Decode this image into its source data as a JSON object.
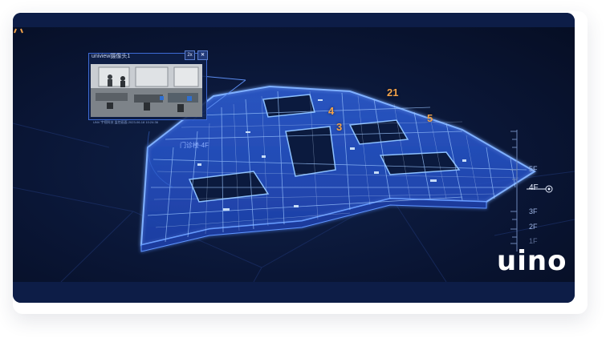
{
  "camera_popup": {
    "title": "uniview摄像头1",
    "zoom_label": "2x",
    "close_label": "✕",
    "caption": "UNV 宇视科技 监控画面 2023-06-18 10:24:36"
  },
  "building": {
    "floor_name": "门诊楼-4F"
  },
  "markers": [
    {
      "label": "21"
    },
    {
      "label": "4"
    },
    {
      "label": "3"
    },
    {
      "label": "5"
    }
  ],
  "floor_selector": {
    "floors": [
      "5F",
      "4F",
      "3F",
      "2F",
      "1F"
    ],
    "active": "4F"
  },
  "brand": {
    "name": "uino"
  },
  "colors": {
    "background": "#0b1a3e",
    "wireframe": "#3a7bff",
    "marker": "#f2a24a",
    "text": "#ffffff"
  }
}
